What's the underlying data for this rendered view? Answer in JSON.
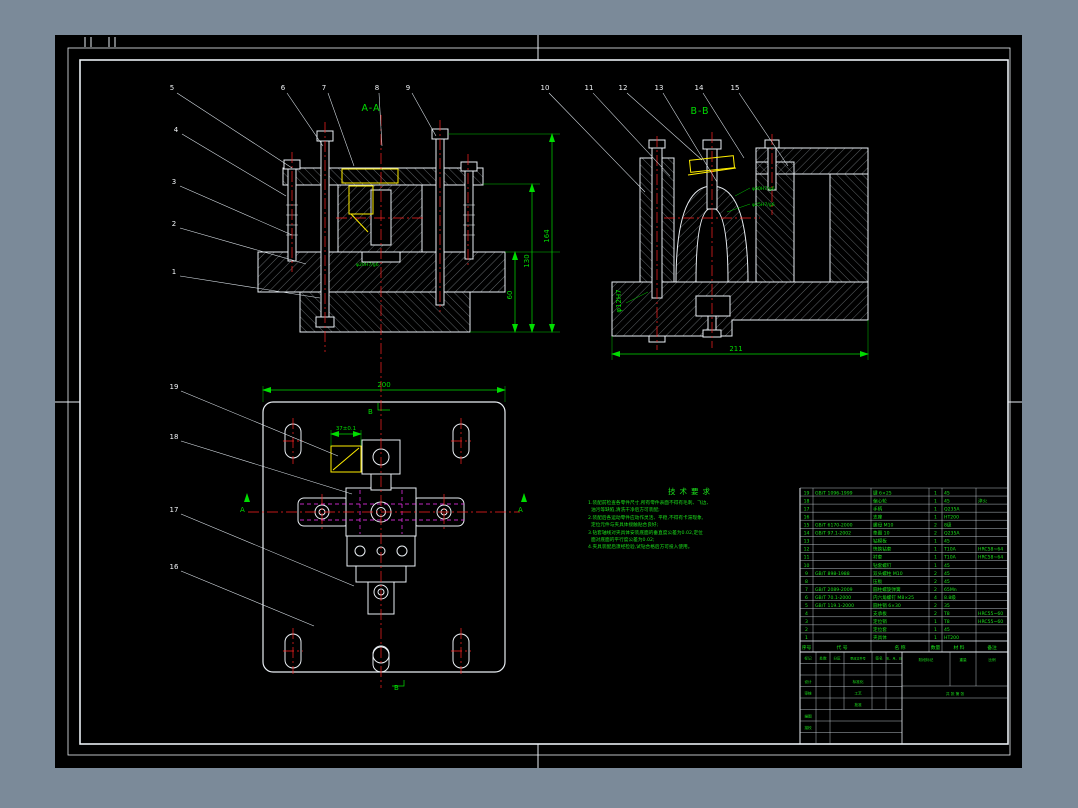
{
  "app": {
    "background_color": "#7b8a99",
    "sheet_color": "#000000",
    "dimension_color": "#00dd00",
    "centerline_color": "#ff2222",
    "hidden_line_color": "#ff35ff",
    "highlight_color": "#ffee00"
  },
  "labels": {
    "section_aa": "A-A",
    "section_bb": "B-B",
    "view_b": "B",
    "view_a": "A"
  },
  "dims": {
    "aa_h1": "164",
    "aa_h2": "130",
    "aa_h3": "60",
    "aa_fit": "φ20H7/g6",
    "bb_w": "211",
    "bb_fit_left": "φ12H7",
    "bb_fit_1": "φ40H7/g6",
    "bb_fit_2": "φ25H7/g6",
    "plan_w": "200",
    "plan_tol": "37±0.1"
  },
  "balloons": [
    "5",
    "6",
    "7",
    "8",
    "9",
    "10",
    "11",
    "12",
    "13",
    "14",
    "15",
    "4",
    "3",
    "2",
    "1",
    "19",
    "18",
    "17",
    "16"
  ],
  "tech": {
    "title": "技术要求",
    "lines": [
      "1.装配前检查各零件尺寸,所有零件表面不得有毛刺、飞边、",
      "  油污等缺陷,清洗干净后方可装配;",
      "2.装配后各运动零件应动作灵活、平稳,不得有卡滞现象,",
      "  定位元件与夹具体接触贴合良好;",
      "3.钻套轴线对夹具体安装底面的垂直度公差为0.02,定位",
      "  面对底面的平行度公差为0.02;",
      "4.夹具装配后须经检验,试钻合格后方可投入使用。"
    ]
  },
  "parts": {
    "header": [
      "序号",
      "代  号",
      "名  称",
      "数量",
      "材  料",
      "备注"
    ],
    "rows": [
      {
        "no": "19",
        "code": "GB/T 1096-1999",
        "name": "键 6×25",
        "qty": "1",
        "mat": "45",
        "rem": ""
      },
      {
        "no": "18",
        "code": "",
        "name": "偏心轮",
        "qty": "1",
        "mat": "45",
        "rem": "淬火"
      },
      {
        "no": "17",
        "code": "",
        "name": "手柄",
        "qty": "1",
        "mat": "Q235A",
        "rem": ""
      },
      {
        "no": "16",
        "code": "",
        "name": "支座",
        "qty": "1",
        "mat": "HT200",
        "rem": ""
      },
      {
        "no": "15",
        "code": "GB/T 6170-2000",
        "name": "螺母 M10",
        "qty": "2",
        "mat": "8级",
        "rem": ""
      },
      {
        "no": "14",
        "code": "GB/T 97.1-2002",
        "name": "垫圈 10",
        "qty": "2",
        "mat": "Q235A",
        "rem": ""
      },
      {
        "no": "13",
        "code": "",
        "name": "钻模板",
        "qty": "1",
        "mat": "45",
        "rem": ""
      },
      {
        "no": "12",
        "code": "",
        "name": "快换钻套",
        "qty": "1",
        "mat": "T10A",
        "rem": "HRC58~64"
      },
      {
        "no": "11",
        "code": "",
        "name": "衬套",
        "qty": "1",
        "mat": "T10A",
        "rem": "HRC58~64"
      },
      {
        "no": "10",
        "code": "",
        "name": "钻套螺钉",
        "qty": "1",
        "mat": "45",
        "rem": ""
      },
      {
        "no": "9",
        "code": "GB/T 898-1988",
        "name": "双头螺柱 M10",
        "qty": "2",
        "mat": "45",
        "rem": ""
      },
      {
        "no": "8",
        "code": "",
        "name": "压板",
        "qty": "2",
        "mat": "45",
        "rem": ""
      },
      {
        "no": "7",
        "code": "GB/T 2089-2009",
        "name": "圆柱螺旋弹簧",
        "qty": "2",
        "mat": "65Mn",
        "rem": ""
      },
      {
        "no": "6",
        "code": "GB/T 70.1-2000",
        "name": "内六角螺钉 M8×25",
        "qty": "4",
        "mat": "8.8级",
        "rem": ""
      },
      {
        "no": "5",
        "code": "GB/T 119.1-2000",
        "name": "圆柱销 6×30",
        "qty": "2",
        "mat": "35",
        "rem": ""
      },
      {
        "no": "4",
        "code": "",
        "name": "支承板",
        "qty": "2",
        "mat": "T8",
        "rem": "HRC55~60"
      },
      {
        "no": "3",
        "code": "",
        "name": "定位销",
        "qty": "1",
        "mat": "T8",
        "rem": "HRC55~60"
      },
      {
        "no": "2",
        "code": "",
        "name": "定位套",
        "qty": "1",
        "mat": "45",
        "rem": ""
      },
      {
        "no": "1",
        "code": "",
        "name": "夹具体",
        "qty": "1",
        "mat": "HT200",
        "rem": ""
      }
    ]
  },
  "titleblock": {
    "mark": "标记",
    "count": "处数",
    "zone": "分区",
    "file": "更改文件号",
    "sign": "签名",
    "date": "年、月、日",
    "design": "设计",
    "audit": "审核",
    "craft": "工艺",
    "standard": "标准化",
    "approve": "批准",
    "trace": "描图",
    "tracecheck": "描校",
    "stage": "阶段标记",
    "weight": "重量",
    "scale": "比例",
    "sheets": "共 张 第 张"
  }
}
